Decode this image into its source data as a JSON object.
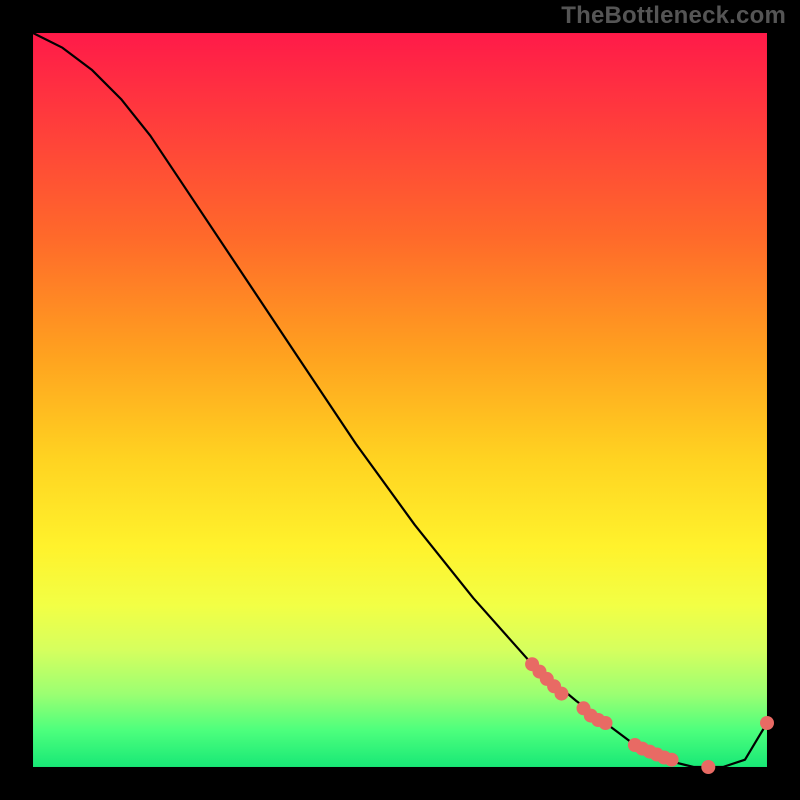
{
  "watermark": "TheBottleneck.com",
  "chart_data": {
    "type": "line",
    "title": "",
    "xlabel": "",
    "ylabel": "",
    "xlim": [
      0,
      100
    ],
    "ylim": [
      0,
      100
    ],
    "grid": false,
    "legend": false,
    "series": [
      {
        "name": "curve",
        "x": [
          0,
          4,
          8,
          12,
          16,
          20,
          28,
          36,
          44,
          52,
          60,
          68,
          74,
          78,
          82,
          86,
          90,
          94,
          97,
          100
        ],
        "y": [
          100,
          98,
          95,
          91,
          86,
          80,
          68,
          56,
          44,
          33,
          23,
          14,
          9,
          6,
          3,
          1,
          0,
          0,
          1,
          6
        ]
      }
    ],
    "markers": [
      {
        "x": 68,
        "y": 14
      },
      {
        "x": 69,
        "y": 13
      },
      {
        "x": 70,
        "y": 12
      },
      {
        "x": 71,
        "y": 11
      },
      {
        "x": 72,
        "y": 10
      },
      {
        "x": 75,
        "y": 8
      },
      {
        "x": 76,
        "y": 7
      },
      {
        "x": 77,
        "y": 6.4
      },
      {
        "x": 78,
        "y": 6
      },
      {
        "x": 82,
        "y": 3
      },
      {
        "x": 83,
        "y": 2.5
      },
      {
        "x": 84,
        "y": 2.1
      },
      {
        "x": 85,
        "y": 1.7
      },
      {
        "x": 86,
        "y": 1.3
      },
      {
        "x": 87,
        "y": 1
      },
      {
        "x": 92,
        "y": 0
      },
      {
        "x": 100,
        "y": 6
      }
    ],
    "marker_color": "#e86a64",
    "line_color": "#000000"
  }
}
